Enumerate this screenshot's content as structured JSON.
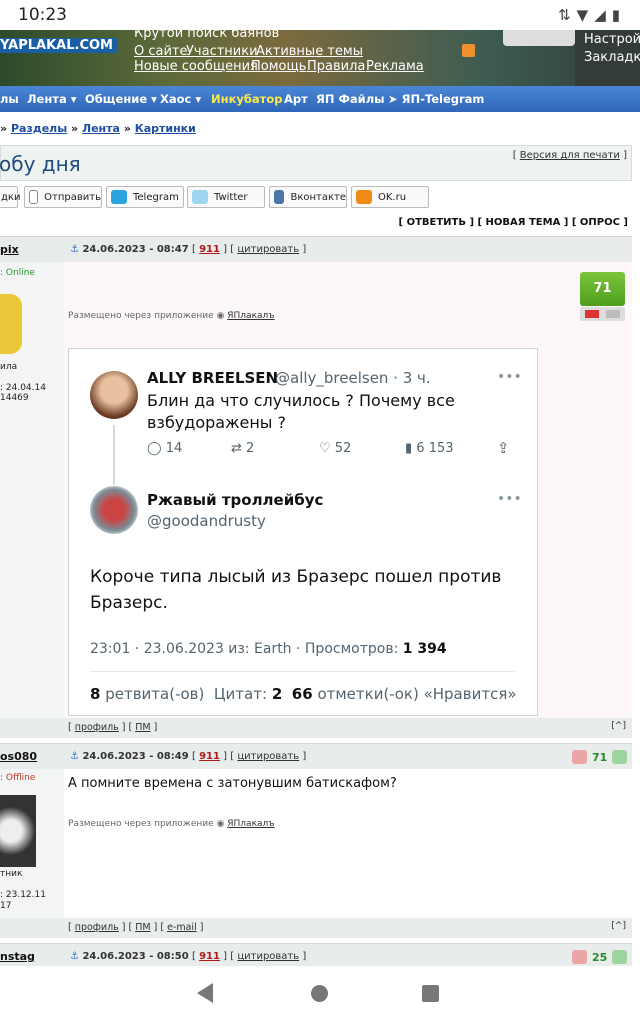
{
  "status_bar": {
    "time": "10:23"
  },
  "site": {
    "logo": "YAPLAKAL.COM",
    "tagline": "Крутой поиск баянов",
    "top_links": [
      "О сайте",
      "Участники",
      "Активные темы",
      "Новые сообщения",
      "Помощь",
      "Правила",
      "Реклама"
    ],
    "right_links": [
      "Настройк",
      "Закладки"
    ]
  },
  "nav": [
    "лы",
    "Лента",
    "Общение",
    "Хаос",
    "Инкубатор",
    "Арт",
    "ЯП Файлы",
    "ЯП-Telegram"
  ],
  "breadcrumbs": [
    "Разделы",
    "Лента",
    "Картинки"
  ],
  "page": {
    "title": "обу дня",
    "print_link": "Версия для печати"
  },
  "share_buttons": [
    "дки",
    "Отправить",
    "Telegram",
    "Twitter",
    "Вконтакте",
    "OK.ru"
  ],
  "reply_actions": "[ ОТВЕТИТЬ ] [ НОВАЯ ТЕМА ] [ ОПРОС ]",
  "posts": [
    {
      "user": "pix",
      "date": "24.06.2023 - 08:47",
      "number": "911",
      "quote": "цитировать",
      "status": ": Online",
      "meta1": "ила",
      "meta2": ": 24.04.14",
      "meta3": "14469",
      "rating": "71",
      "via": "Размещено через приложение",
      "app": "ЯПлакалъ",
      "footer_links": [
        "профиль",
        "ПМ"
      ]
    },
    {
      "user": "os080",
      "date": "24.06.2023 - 08:49",
      "number": "911",
      "quote": "цитировать",
      "status": ": Offline",
      "meta1": "тник",
      "meta2": ": 23.12.11",
      "meta3": "17",
      "rating": "71",
      "text": "А помните времена с затонувшим батискафом?",
      "via": "Размещено через приложение",
      "app": "ЯПлакалъ",
      "footer_links": [
        "профиль",
        "ПМ",
        "e-mail"
      ]
    },
    {
      "user": "nstag",
      "date": "24.06.2023 - 08:50",
      "number": "911",
      "quote": "цитировать",
      "rating": "25"
    }
  ],
  "tweet": {
    "reply_name": "ALLY BREELSEN",
    "reply_handle": "@ally_breelsen · 3 ч.",
    "reply_text_1": "Блин да что случилось ? Почему все",
    "reply_text_2": "взбудоражены ?",
    "stats": {
      "replies": "14",
      "retweets": "2",
      "likes": "52",
      "views": "6 153"
    },
    "author_name": "Ржавый троллейбус",
    "author_handle": "@goodandrusty",
    "text_1": "Короче типа лысый из Бразерс пошел против",
    "text_2": "Бразерс.",
    "meta_prefix": "23:01 · 23.06.2023 из: Earth · Просмотров:",
    "meta_views": "1 394",
    "retweets_count": "8",
    "retweets_label": "ретвита(-ов)",
    "quotes_label": "Цитат:",
    "quotes_count": "2",
    "likes_count": "66",
    "likes_label": "отметки(-ок) «Нравится»"
  },
  "colors": {
    "nav_bg": "#3a74c8",
    "rating_green": "#5fae28",
    "link_blue": "#1f4fa0",
    "post_num_red": "#b01818"
  }
}
